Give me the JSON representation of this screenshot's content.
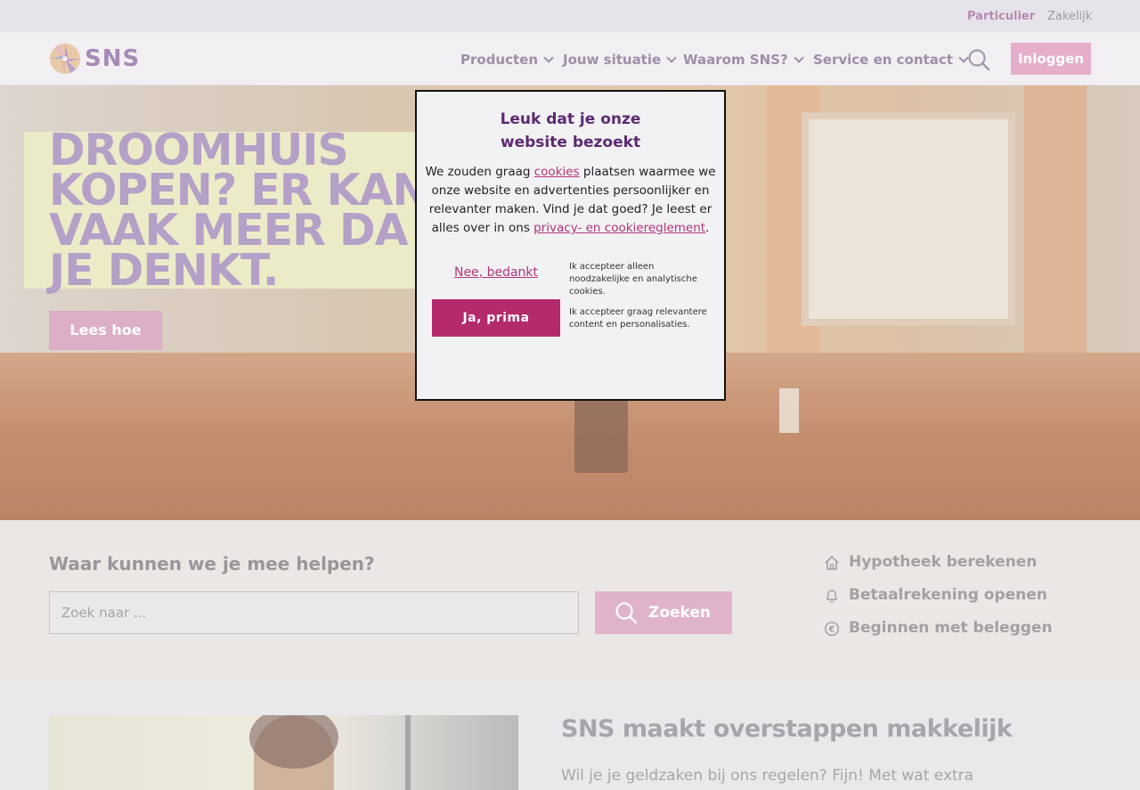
{
  "topbar": {
    "segment_private": "Particulier",
    "segment_business": "Zakelijk"
  },
  "nav": {
    "logo_text": "SNS",
    "items": [
      {
        "label": "Producten"
      },
      {
        "label": "Jouw situatie"
      },
      {
        "label": "Waarom SNS?"
      },
      {
        "label": "Service en contact"
      }
    ],
    "search_icon": "search-icon",
    "login_label": "Inloggen"
  },
  "hero": {
    "title": "DROOMHUIS\nKOPEN? ER KAN\nVAAK MEER DA\nJE DENKT.",
    "button_label": "Lees hoe"
  },
  "consent": {
    "title": "Leuk dat je onze website bezoekt",
    "body_before_cookies": "We zouden graag ",
    "cookies_link": "cookies",
    "body_after_cookies": " plaatsen waarmee we onze website en advertenties persoonlijker en relevanter maken. Vind je dat goed? Je leest er alles over in ons ",
    "privacy_link": "privacy- en cookiereglement",
    "body_end": ".",
    "decline_label": "Nee, bedankt",
    "decline_note": "Ik accepteer alleen noodzakelijke en analytische cookies.",
    "accept_label": "Ja, prima",
    "accept_note": "Ik accepteer graag relevantere content en personalisaties."
  },
  "help": {
    "title": "Waar kunnen we je mee helpen?",
    "search_placeholder": "Zoek naar ...",
    "search_button": "Zoeken",
    "quick_links": [
      {
        "label": "Hypotheek berekenen",
        "icon": "house-icon"
      },
      {
        "label": "Betaalrekening openen",
        "icon": "bell-icon"
      },
      {
        "label": "Beginnen met beleggen",
        "icon": "euro-icon"
      }
    ]
  },
  "feature": {
    "title": "SNS maakt overstappen makkelijk",
    "text": "Wil je je geldzaken bij ons regelen? Fijn! Met wat extra"
  },
  "colors": {
    "brand_purple": "#5b2b71",
    "brand_magenta": "#b42a6b",
    "login_pink": "#e6aecb"
  }
}
